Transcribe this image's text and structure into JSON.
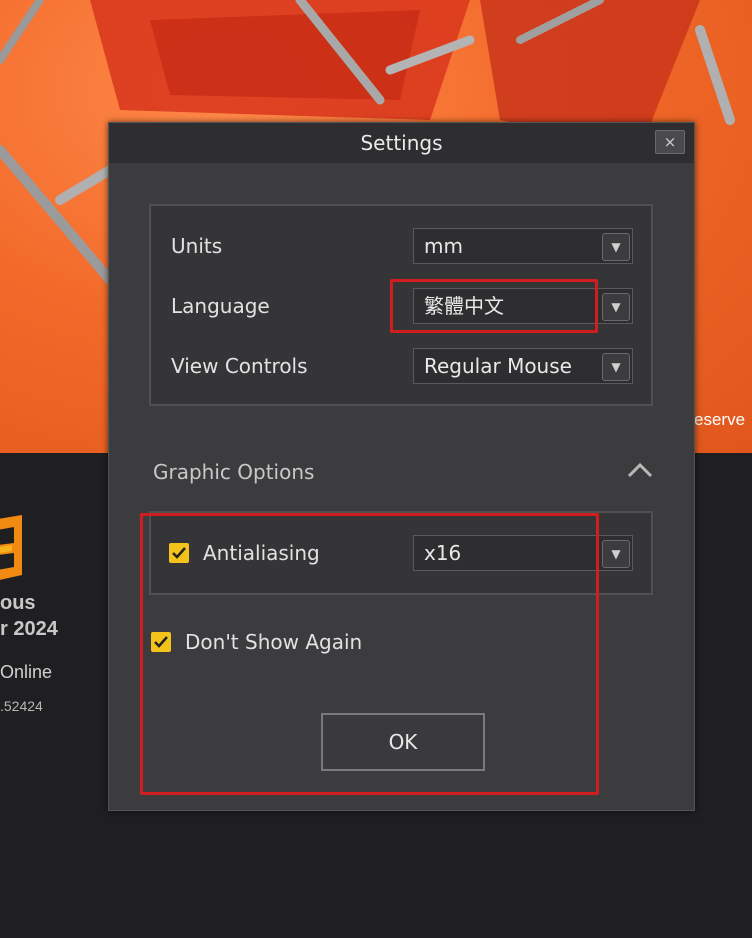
{
  "background": {
    "rights_text": "eserve",
    "brand_line1": "ous",
    "brand_line2": "r 2024",
    "brand_line3": "Online",
    "brand_line4": ".52424"
  },
  "dialog": {
    "title": "Settings",
    "close_glyph": "×",
    "units": {
      "label": "Units",
      "value": "mm"
    },
    "language": {
      "label": "Language",
      "value": "繁體中文"
    },
    "view_controls": {
      "label": "View Controls",
      "value": "Regular Mouse"
    },
    "graphic_options": {
      "title": "Graphic Options",
      "antialiasing": {
        "label": "Antialiasing",
        "checked": true,
        "value": "x16"
      }
    },
    "dont_show_again": {
      "label": "Don't Show Again",
      "checked": true
    },
    "ok_label": "OK"
  },
  "colors": {
    "accent_checkbox": "#f3c21b",
    "highlight_red": "#d01e1e",
    "splash_orange": "#f26a2a"
  },
  "icons": {
    "select_arrow": "triangle-down",
    "collapse": "chevron-up",
    "close": "close-icon"
  }
}
